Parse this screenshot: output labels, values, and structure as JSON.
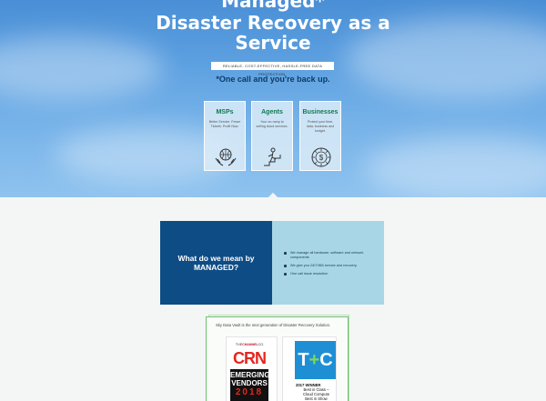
{
  "hero": {
    "title_line1": "Managed*",
    "title_line2": "Disaster Recovery as a",
    "title_line3": "Service",
    "tagline": "RELIABLE, COST-EFFECTIVE, HASSLE-FREE DATA PROTECTION.",
    "subtagline": "*One call and you're back up."
  },
  "cards": [
    {
      "title": "MSPs",
      "text": "Better Service. Fewer Tickets. Profit Now.",
      "icon": "hands-globe-icon"
    },
    {
      "title": "Agents",
      "text": "Your on-ramp to selling cloud services.",
      "icon": "climbing-person-icon"
    },
    {
      "title": "Businesses",
      "text": "Protect your time, data, business and budget.",
      "icon": "dollar-dial-icon"
    }
  ],
  "managed": {
    "heading": "What do we mean by MANAGED?",
    "bullets": [
      "We manage all hardware, software and network components",
      "We give you 24/7/365 service and recovery.",
      "One call issue resolution"
    ]
  },
  "awards": {
    "intro": "Sky Data Vault is the next generation of Disaster Recovery Solution.",
    "crn": {
      "channel_prefix": "THE",
      "channel_brand": "CHANNEL",
      "channel_suffix": "CO.",
      "logo": "CRN",
      "line1": "EMERGING",
      "line2": "VENDORS",
      "year": "2018"
    },
    "tc": {
      "logo_left": "T",
      "logo_plus": "+",
      "logo_right": "C",
      "winner": "2017 WINNER",
      "award_line1": "Best in Class –",
      "award_line2": "Cloud Compute",
      "award_line3": "Best in Show"
    }
  },
  "colors": {
    "hero_sky": "#5b9fe0",
    "managed_blue": "#0e4c85",
    "managed_light": "#a9d6e6",
    "card_title_green": "#0e7a4f",
    "crn_red": "#e5261f",
    "tc_blue": "#1e8fd5"
  }
}
